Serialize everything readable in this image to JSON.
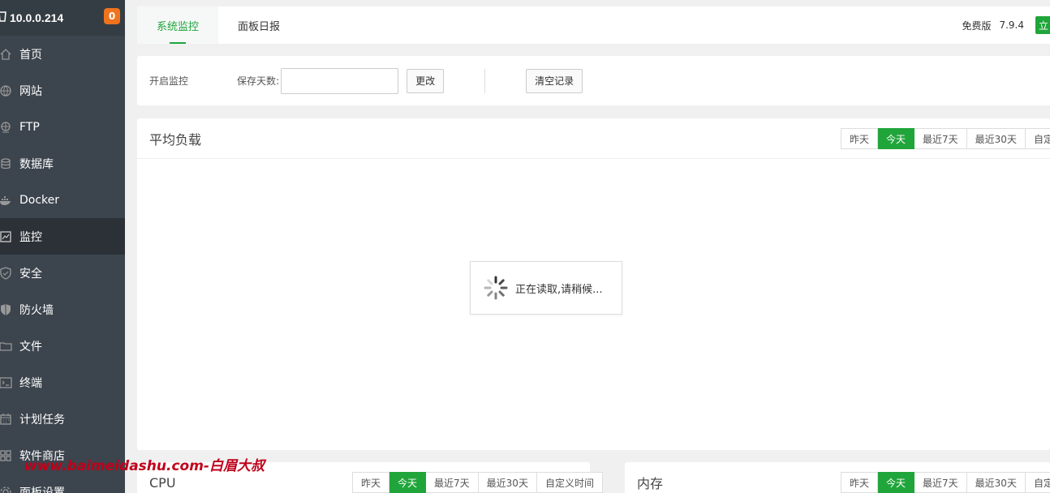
{
  "sidebar": {
    "host_ip": "10.0.0.214",
    "badge": "0",
    "items": [
      {
        "label": "首页",
        "icon": "home-icon"
      },
      {
        "label": "网站",
        "icon": "globe-icon"
      },
      {
        "label": "FTP",
        "icon": "ftp-icon"
      },
      {
        "label": "数据库",
        "icon": "database-icon"
      },
      {
        "label": "Docker",
        "icon": "docker-icon"
      },
      {
        "label": "监控",
        "icon": "monitor-icon",
        "active": true
      },
      {
        "label": "安全",
        "icon": "shield-icon"
      },
      {
        "label": "防火墙",
        "icon": "firewall-icon"
      },
      {
        "label": "文件",
        "icon": "folder-icon"
      },
      {
        "label": "终端",
        "icon": "terminal-icon"
      },
      {
        "label": "计划任务",
        "icon": "calendar-icon"
      },
      {
        "label": "软件商店",
        "icon": "apps-icon"
      },
      {
        "label": "面板设置",
        "icon": "settings-icon"
      }
    ]
  },
  "tabs": {
    "system_monitor": "系统监控",
    "panel_daily": "面板日报",
    "edition": "免费版",
    "version": "7.9.4",
    "upgrade": "立"
  },
  "toolbar": {
    "enable_label": "开启监控",
    "keep_days_label": "保存天数:",
    "keep_days_value": "",
    "change_button": "更改",
    "clear_button": "清空记录"
  },
  "range_buttons": {
    "yesterday": "昨天",
    "today": "今天",
    "last7": "最近7天",
    "last30": "最近30天",
    "custom_short": "自定",
    "custom": "自定义时间"
  },
  "panels": {
    "load_title": "平均负载",
    "loading_text": "正在读取,请稍候...",
    "cpu_title": "CPU",
    "mem_title": "内存"
  },
  "watermark": "www.baimeidashu.com-白眉大叔",
  "colors": {
    "accent": "#20a53a",
    "sidebar_bg": "#3c444d",
    "badge": "#f0731e"
  }
}
